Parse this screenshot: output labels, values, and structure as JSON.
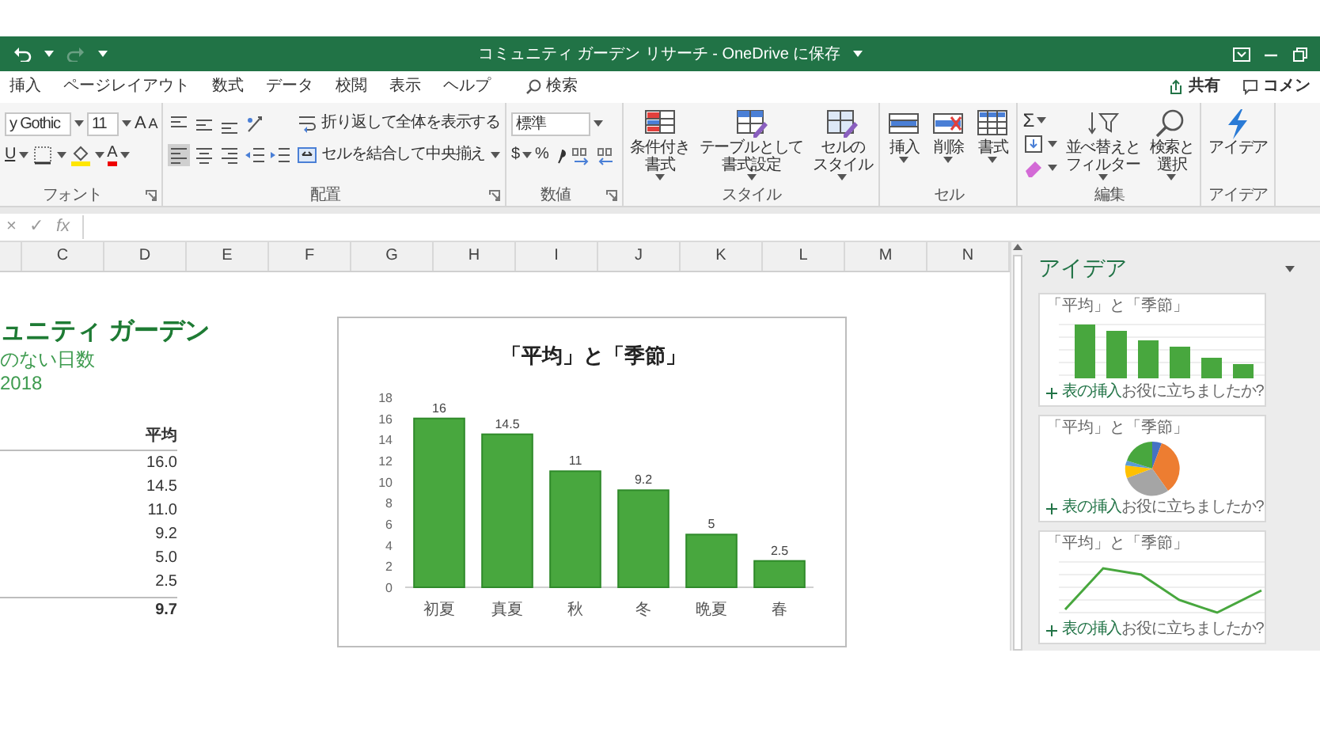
{
  "window": {
    "title": "コミュニティ ガーデン リサーチ - OneDrive に保存"
  },
  "ribbon_tabs": [
    {
      "label": "挿入"
    },
    {
      "label": "ページレイアウト"
    },
    {
      "label": "数式"
    },
    {
      "label": "データ"
    },
    {
      "label": "校閲"
    },
    {
      "label": "表示"
    },
    {
      "label": "ヘルプ"
    }
  ],
  "search": {
    "label": "検索"
  },
  "share": {
    "label": "共有"
  },
  "comments": {
    "label": "コメン"
  },
  "ribbon_groups": [
    {
      "kind": "font",
      "label": "フォント",
      "font_name": "y Gothic",
      "font_size": "11",
      "grow": "A",
      "shrink": "A",
      "underline": "U",
      "font_color": "A"
    },
    {
      "kind": "alignment",
      "label": "配置",
      "align_buttons": [
        {
          "selected": true
        },
        {
          "selected": false
        },
        {
          "selected": false
        }
      ],
      "wrap": "折り返して全体を表示する",
      "merge": "セルを結合して中央揃え"
    },
    {
      "kind": "number",
      "label": "数値",
      "format": "標準",
      "currency": "$",
      "percent": "%"
    },
    {
      "kind": "styles",
      "label": "スタイル",
      "buttons": [
        {
          "lines": [
            "条件付き",
            "書式"
          ],
          "dropdown": true
        },
        {
          "lines": [
            "テーブルとして",
            "書式設定"
          ],
          "dropdown": true
        },
        {
          "lines": [
            "セルの",
            "スタイル"
          ],
          "dropdown": true
        }
      ]
    },
    {
      "kind": "cells",
      "label": "セル",
      "buttons": [
        {
          "lines": [
            "挿入"
          ],
          "dropdown": true
        },
        {
          "lines": [
            "削除"
          ],
          "dropdown": true
        },
        {
          "lines": [
            "書式"
          ],
          "dropdown": true
        }
      ]
    },
    {
      "kind": "editing",
      "label": "編集",
      "sum": "Σ",
      "buttons": [
        {
          "lines": [
            "並べ替えと",
            "フィルター"
          ],
          "dropdown": true
        },
        {
          "lines": [
            "検索と",
            "選択"
          ],
          "dropdown": true
        }
      ]
    },
    {
      "kind": "ideas",
      "label": "アイデア",
      "buttons": [
        {
          "lines": [
            "アイデア"
          ],
          "dropdown": false
        }
      ]
    }
  ],
  "formula_bar": {
    "cancel": "×",
    "enter": "✓",
    "function": "fx"
  },
  "columns": [
    "C",
    "D",
    "E",
    "F",
    "G",
    "H",
    "I",
    "J",
    "K",
    "L",
    "M",
    "N"
  ],
  "sheet": {
    "title": "ュニティ ガーデン",
    "subtitle": "のない日数",
    "year": "2018",
    "table": {
      "header": "平均",
      "rows": [
        "16.0",
        "14.5",
        "11.0",
        "9.2",
        "5.0",
        "2.5"
      ],
      "total": "9.7"
    }
  },
  "chart": {
    "chart_data": {
      "type": "bar",
      "title": "「平均」と「季節」",
      "categories": [
        "初夏",
        "真夏",
        "秋",
        "冬",
        "晩夏",
        "春"
      ],
      "values": [
        16,
        14.5,
        11,
        9.2,
        5,
        2.5
      ],
      "ylim": [
        0,
        18
      ],
      "yticks": [
        0,
        2,
        4,
        6,
        8,
        10,
        12,
        14,
        16,
        18
      ],
      "data_labels": true
    }
  },
  "ideas_pane": {
    "title": "アイデア",
    "cards": [
      {
        "kind": "bar",
        "title": "「平均」と「季節」",
        "insert": "表の挿入",
        "feedback": "お役に立ちましたか?"
      },
      {
        "kind": "pie",
        "title": "「平均」と「季節」",
        "insert": "表の挿入",
        "feedback": "お役に立ちましたか?"
      },
      {
        "kind": "line",
        "title": "「平均」と「季節」",
        "insert": "表の挿入",
        "feedback": "お役に立ちましたか?"
      }
    ]
  }
}
